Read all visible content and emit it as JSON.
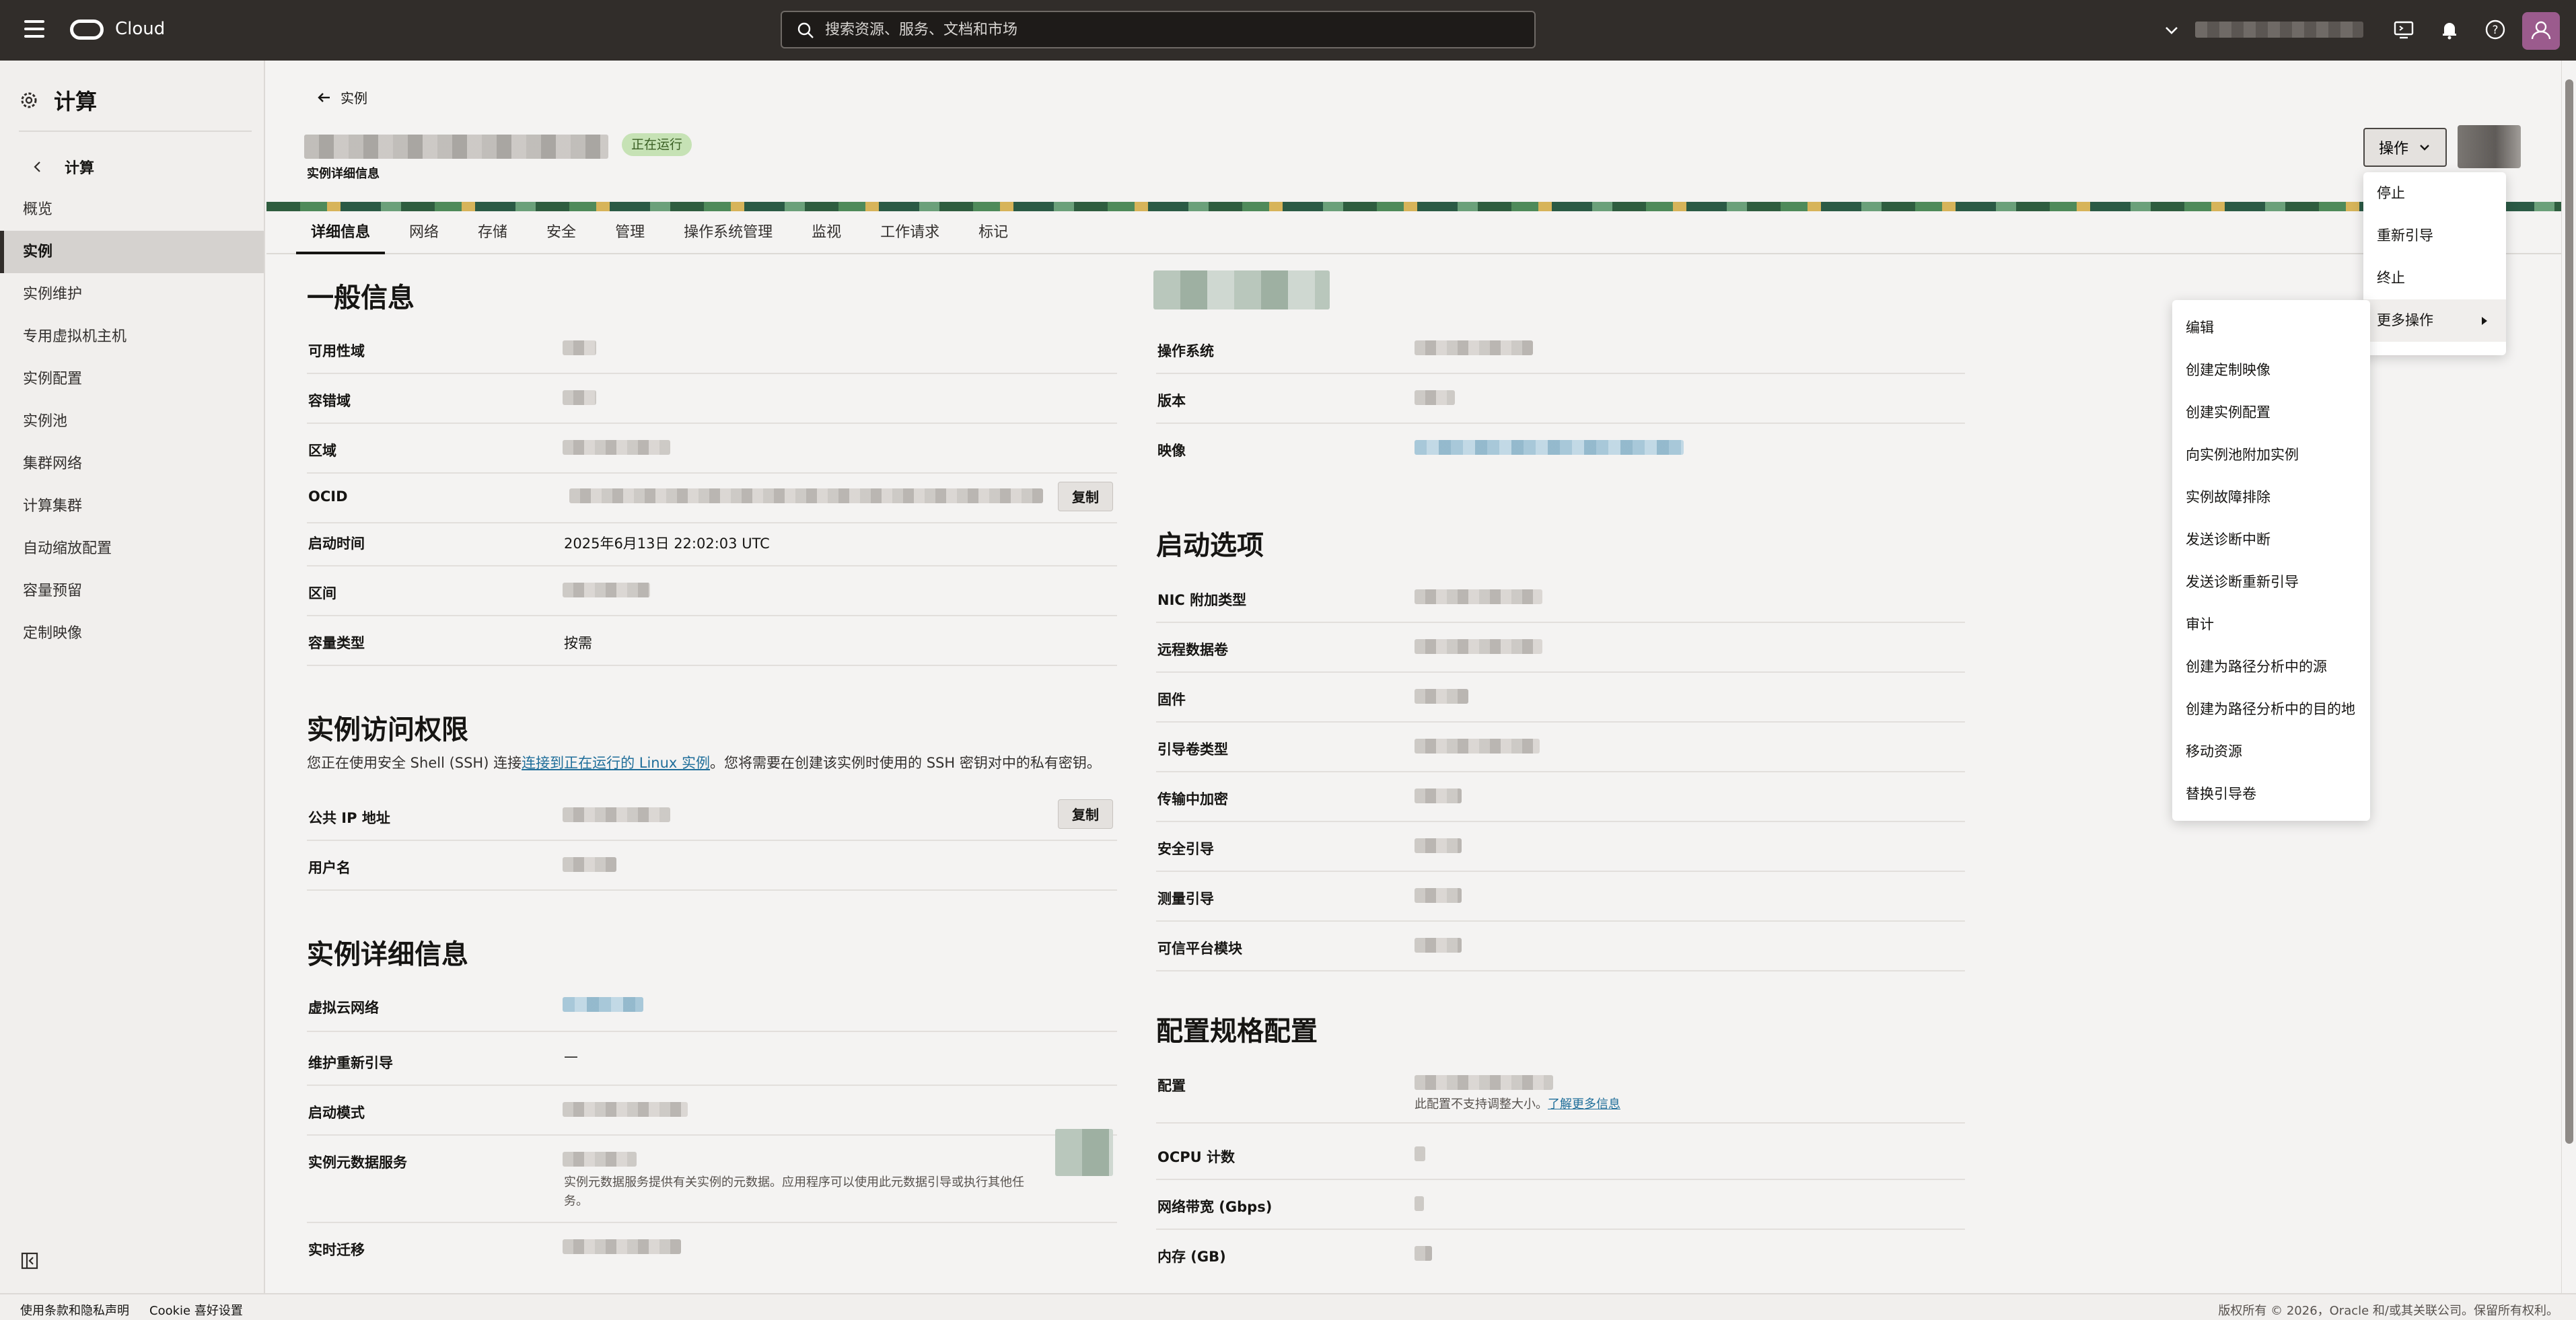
{
  "topbar": {
    "brand": "Cloud",
    "search_placeholder": "搜索资源、服务、文档和市场"
  },
  "sidebar": {
    "title": "计算",
    "back_label": "计算",
    "items": [
      {
        "label": "概览",
        "active": false
      },
      {
        "label": "实例",
        "active": true
      },
      {
        "label": "实例维护",
        "active": false
      },
      {
        "label": "专用虚拟机主机",
        "active": false
      },
      {
        "label": "实例配置",
        "active": false
      },
      {
        "label": "实例池",
        "active": false
      },
      {
        "label": "集群网络",
        "active": false
      },
      {
        "label": "计算集群",
        "active": false
      },
      {
        "label": "自动缩放配置",
        "active": false
      },
      {
        "label": "容量预留",
        "active": false
      },
      {
        "label": "定制映像",
        "active": false
      }
    ]
  },
  "header": {
    "back_label": "实例",
    "status": "正在运行",
    "subtitle": "实例详细信息",
    "actions_label": "操作"
  },
  "tabs": [
    "详细信息",
    "网络",
    "存储",
    "安全",
    "管理",
    "操作系统管理",
    "监视",
    "工作请求",
    "标记"
  ],
  "general": {
    "title": "一般信息",
    "availability_domain": "可用性域",
    "fault_domain": "容错域",
    "region": "区域",
    "ocid": "OCID",
    "copy": "复制",
    "launched": "启动时间",
    "launched_value": "2025年6月13日 22:02:03 UTC",
    "compartment": "区间",
    "capacity_type": "容量类型",
    "capacity_type_value": "按需"
  },
  "access": {
    "title": "实例访问权限",
    "desc_before": "您正在使用安全 Shell (SSH) 连接",
    "desc_link": "连接到正在运行的 Linux 实例",
    "desc_after": "。您将需要在创建该实例时使用的 SSH 密钥对中的私有密钥。",
    "public_ip": "公共 IP 地址",
    "copy": "复制",
    "username": "用户名"
  },
  "details": {
    "title": "实例详细信息",
    "vcn": "虚拟云网络",
    "maint_reboot": "维护重新引导",
    "maint_reboot_value": "—",
    "launch_mode": "启动模式",
    "metadata_service": "实例元数据服务",
    "metadata_note": "实例元数据服务提供有关实例的元数据。应用程序可以使用此元数据引导或执行其他任务。",
    "live_migration": "实时迁移"
  },
  "image_section": {
    "os": "操作系统",
    "version": "版本",
    "image": "映像"
  },
  "launch": {
    "title": "启动选项",
    "nic": "NIC 附加类型",
    "remote_volume": "远程数据卷",
    "firmware": "固件",
    "boot_volume_type": "引导卷类型",
    "in_transit": "传输中加密",
    "secure_boot": "安全引导",
    "measured_boot": "测量引导",
    "tpm": "可信平台模块"
  },
  "shape": {
    "title": "配置规格配置",
    "shape": "配置",
    "note": "此配置不支持调整大小。",
    "note_link": "了解更多信息",
    "ocpu": "OCPU 计数",
    "bandwidth": "网络带宽 (Gbps)",
    "memory": "内存 (GB)"
  },
  "actions_menu": [
    {
      "label": "停止"
    },
    {
      "label": "重新引导"
    },
    {
      "label": "终止"
    },
    {
      "label": "更多操作"
    }
  ],
  "more_menu": [
    "编辑",
    "创建定制映像",
    "创建实例配置",
    "向实例池附加实例",
    "实例故障排除",
    "发送诊断中断",
    "发送诊断重新引导",
    "审计",
    "创建为路径分析中的源",
    "创建为路径分析中的目的地",
    "移动资源",
    "替换引导卷"
  ],
  "footer": {
    "terms": "使用条款和隐私声明",
    "cookie": "Cookie 喜好设置",
    "copyright": "版权所有 © 2026，Oracle 和/或其关联公司。保留所有权利。"
  },
  "colors": {
    "topbar": "#312d2a",
    "status_bg": "#c6e2b5",
    "link": "#1f6e9a"
  }
}
